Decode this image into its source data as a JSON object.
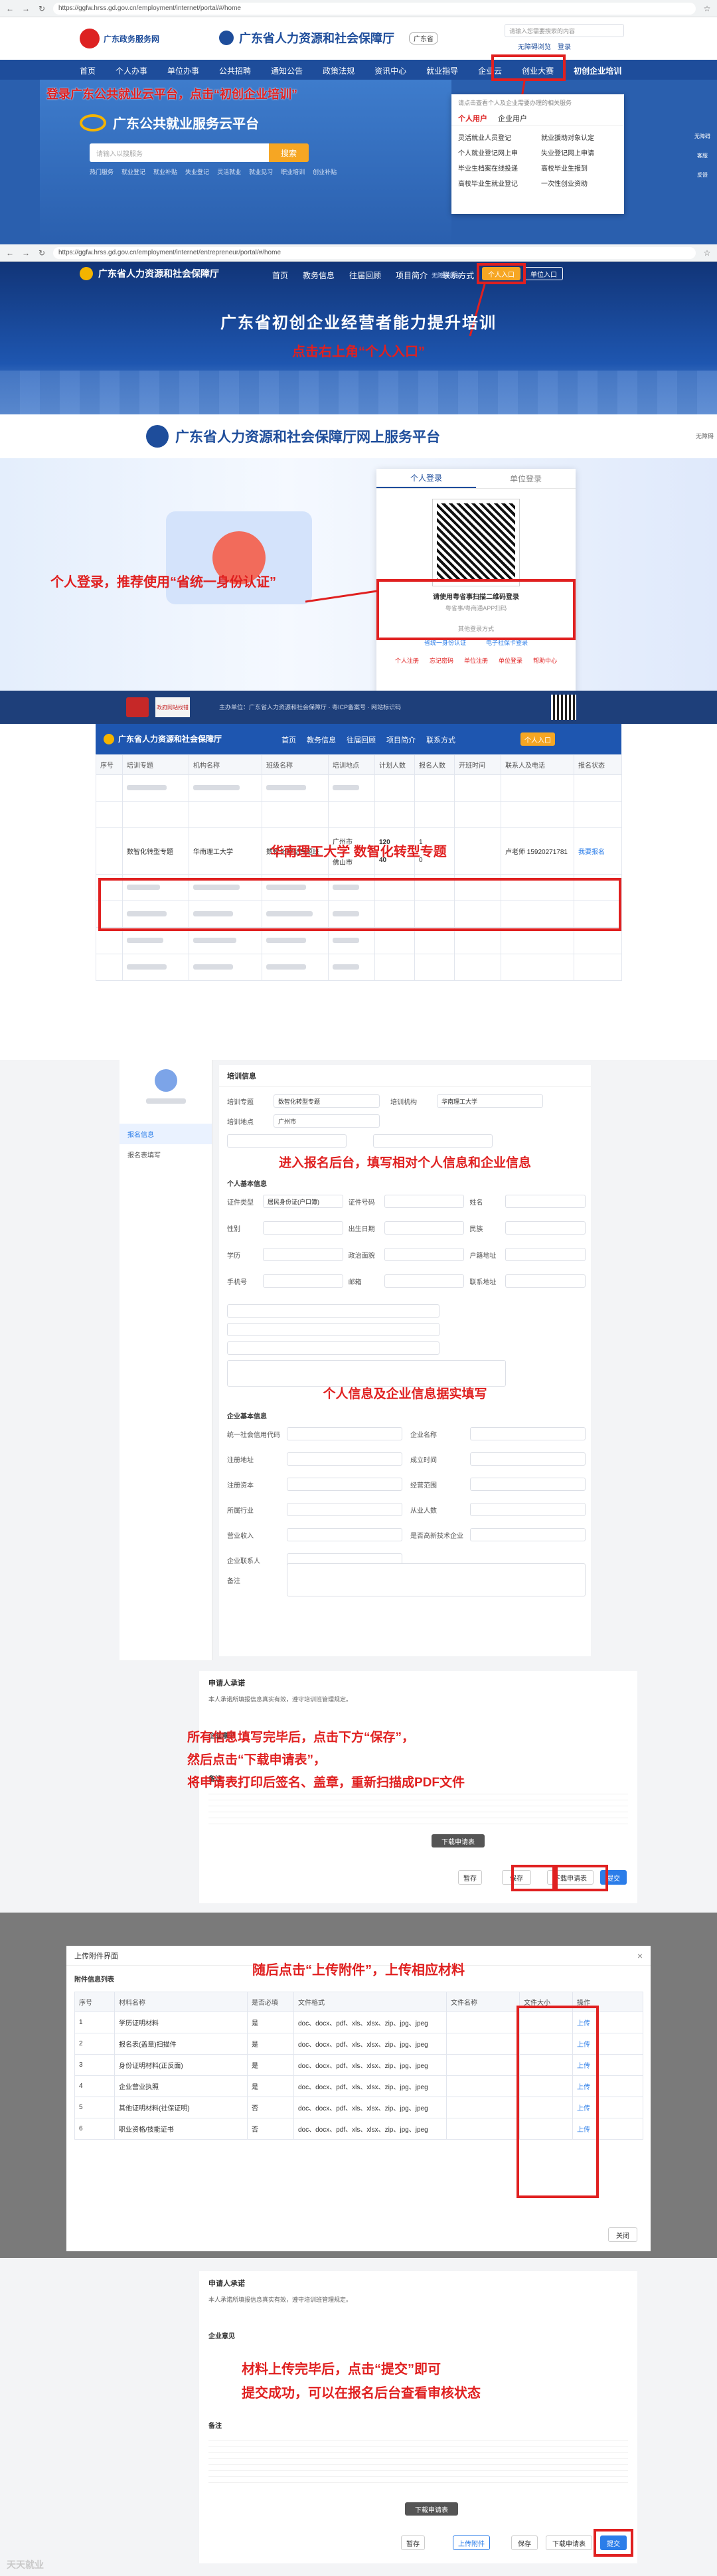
{
  "s1": {
    "url": "https://ggfw.hrss.gd.gov.cn/employment/internet/portal/#/home",
    "gov_badge": "广东政务服务网",
    "dept_title": "广东省人力资源和社会保障厅",
    "region": "广东省",
    "top_search_ph": "请输入您需要搜索的内容",
    "top_right": [
      "无障碍浏览",
      "登录"
    ],
    "nav": [
      "首页",
      "个人办事",
      "单位办事",
      "公共招聘",
      "通知公告",
      "政策法规",
      "资讯中心",
      "就业指导",
      "企业云",
      "创业大赛",
      "初创企业培训"
    ],
    "platform_title": "广东公共就业服务云平台",
    "search_ph": "请输入以搜服务",
    "search_btn": "搜索",
    "hot_label": "热门服务",
    "hot_links": [
      "就业登记",
      "就业补贴",
      "失业登记",
      "灵活就业",
      "就业见习",
      "职业培训",
      "创业补贴"
    ],
    "callout": "登录广东公共就业云平台，点击“初创企业培训”",
    "dropdown_hint": "请点击查看个人及企业需要办理的相关服务",
    "dropdown_tabs": [
      "个人用户",
      "企业用户"
    ],
    "dropdown_items": [
      "灵活就业人员登记",
      "就业援助对象认定",
      "个人就业登记网上申",
      "失业登记网上申请",
      "毕业生档案在线投递",
      "高校毕业生报到",
      "高校毕业生就业登记",
      "一次性创业资助"
    ],
    "side_icons": [
      "无障碍",
      "客服",
      "反馈"
    ]
  },
  "s2": {
    "url": "https://ggfw.hrss.gd.gov.cn/employment/internet/entrepreneur/portal/#/home",
    "logo": "广东省人力资源和社会保障厅",
    "nav": [
      "首页",
      "教务信息",
      "往届回顾",
      "项目简介",
      "联系方式"
    ],
    "login_hint": "无障碍浏览",
    "personal_btn": "个人入口",
    "unit_btn": "单位入口",
    "banner_title": "广东省初创企业经营者能力提升培训",
    "callout": "点击右上角“个人入口”"
  },
  "s3": {
    "logo_title": "广东省人力资源和社会保障厅网上服务平台",
    "assist": "无障碍",
    "tabs": [
      "个人登录",
      "单位登录"
    ],
    "qr_caption": "请使用粤省事扫描二维码登录",
    "qr_sub": "粤省事/粤商通APP扫码",
    "other_title": "其他登录方式",
    "other_methods": [
      "省统一身份认证",
      "电子社保卡登录"
    ],
    "links": [
      "个人注册",
      "忘记密码",
      "单位注册",
      "单位登录",
      "帮助中心"
    ],
    "callout": "个人登录，推荐使用“省统一身份认证”",
    "footer_seal": "政府网站找错",
    "footer_text": "主办单位：广东省人力资源和社会保障厅 · 粤ICP备案号 · 网站标识码"
  },
  "s4": {
    "nav": [
      "首页",
      "教务信息",
      "往届回顾",
      "项目简介",
      "联系方式"
    ],
    "personal_btn": "个人入口",
    "headers": [
      "序号",
      "培训专题",
      "机构名称",
      "班级名称",
      "培训地点",
      "计划人数",
      "报名人数",
      "开班时间",
      "联系人及电话",
      "报名状态"
    ],
    "callout": "华南理工大学 数智化转型专题",
    "highlight": {
      "no": "",
      "topic": "数智化转型专题",
      "org": "华南理工大学",
      "class": "数智化转型专题班",
      "place1": "广州市",
      "plan1": "120",
      "num1": "1",
      "place2": "佛山市",
      "plan2": "40",
      "num2": "0",
      "contact": "卢老师 15920271781",
      "status": "我要报名"
    }
  },
  "s5": {
    "sidebar_items": [
      "报名信息",
      "报名表填写"
    ],
    "section_title": "培训信息",
    "callout1": "进入报名后台，填写相对个人信息和企业信息",
    "personal_title": "个人基本信息",
    "personal_labels": [
      "证件类型",
      "证件号码",
      "姓名",
      "性别",
      "出生日期",
      "民族",
      "学历",
      "政治面貌",
      "户籍地址",
      "手机号",
      "邮箱",
      "联系地址"
    ],
    "id_type_value": "居民身份证(户口簿)",
    "callout2": "个人信息及企业信息据实填写",
    "company_title": "企业基本信息",
    "company_labels": [
      "统一社会信用代码",
      "企业名称",
      "注册地址",
      "成立时间",
      "注册资本",
      "经营范围",
      "所属行业",
      "从业人数",
      "营业收入",
      "是否高新技术企业",
      "企业联系人"
    ],
    "remark_label": "备注",
    "topic_label": "培训专题",
    "topic_value": "数智化转型专题",
    "org_label": "培训机构",
    "org_value": "华南理工大学",
    "place_label": "培训地点",
    "place_value": "广州市"
  },
  "s6": {
    "section": "申请人承诺",
    "promise": "本人承诺所填报信息真实有效，遵守培训班管理规定。",
    "opinion_title": "企业意见",
    "notes_title": "备注",
    "callout_l1": "所有信息填写完毕后，点击下方“保存”，",
    "callout_l2": "然后点击“下载申请表”，",
    "callout_l3": "将申请表打印后签名、盖章，重新扫描成PDF文件",
    "buttons": [
      "暂存",
      "保存",
      "下载申请表",
      "提交"
    ],
    "mid_btn": "下载申请表"
  },
  "s7": {
    "dialog_title": "上传附件界面",
    "table_title": "附件信息列表",
    "headers": [
      "序号",
      "材料名称",
      "是否必填",
      "文件格式",
      "文件名称",
      "文件大小",
      "操作"
    ],
    "callout": "随后点击“上传附件”，上传相应材料",
    "rows": [
      {
        "no": "1",
        "name": "学历证明材料",
        "req": "是",
        "fmt": "doc、docx、pdf、xls、xlsx、zip、jpg、jpeg",
        "op": "上传"
      },
      {
        "no": "2",
        "name": "报名表(盖章)扫描件",
        "req": "是",
        "fmt": "doc、docx、pdf、xls、xlsx、zip、jpg、jpeg",
        "op": "上传"
      },
      {
        "no": "3",
        "name": "身份证明材料(正反面)",
        "req": "是",
        "fmt": "doc、docx、pdf、xls、xlsx、zip、jpg、jpeg",
        "op": "上传"
      },
      {
        "no": "4",
        "name": "企业营业执照",
        "req": "是",
        "fmt": "doc、docx、pdf、xls、xlsx、zip、jpg、jpeg",
        "op": "上传"
      },
      {
        "no": "5",
        "name": "其他证明材料(社保证明)",
        "req": "否",
        "fmt": "doc、docx、pdf、xls、xlsx、zip、jpg、jpeg",
        "op": "上传"
      },
      {
        "no": "6",
        "name": "职业资格/技能证书",
        "req": "否",
        "fmt": "doc、docx、pdf、xls、xlsx、zip、jpg、jpeg",
        "op": "上传"
      }
    ],
    "close_btn": "关闭"
  },
  "s8": {
    "section": "申请人承诺",
    "promise": "本人承诺所填报信息真实有效，遵守培训班管理规定。",
    "opinion_title": "企业意见",
    "notes_title": "备注",
    "callout_l1": "材料上传完毕后，点击“提交”即可",
    "callout_l2": "提交成功，可以在报名后台查看审核状态",
    "buttons": [
      "暂存",
      "上传附件",
      "保存",
      "下载申请表",
      "提交"
    ],
    "mid_btn": "下载申请表",
    "watermark": "天天就业"
  }
}
